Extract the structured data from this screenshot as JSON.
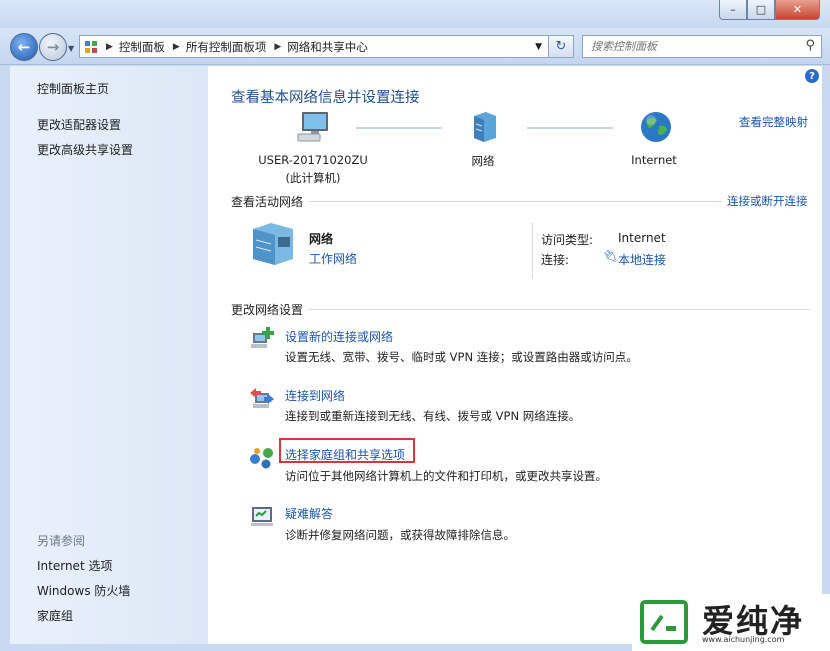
{
  "window": {
    "min_icon": "minimize-icon",
    "max_icon": "maximize-icon",
    "close_icon": "close-icon"
  },
  "nav": {
    "breadcrumbs": [
      "控制面板",
      "所有控制面板项",
      "网络和共享中心"
    ],
    "search_placeholder": "搜索控制面板"
  },
  "sidebar": {
    "home": "控制面板主页",
    "items": [
      "更改适配器设置",
      "更改高级共享设置"
    ],
    "see_also_title": "另请参阅",
    "see_also": [
      "Internet 选项",
      "Windows 防火墙",
      "家庭组"
    ]
  },
  "main": {
    "title": "查看基本网络信息并设置连接",
    "full_map_link": "查看完整映射",
    "map": {
      "computer_name": "USER-20171020ZU",
      "computer_sub": "(此计算机)",
      "network": "网络",
      "internet": "Internet"
    },
    "active_section": "查看活动网络",
    "connect_disconnect": "连接或断开连接",
    "active_network": {
      "name": "网络",
      "type_link": "工作网络",
      "access_label": "访问类型:",
      "access_value": "Internet",
      "conn_label": "连接:",
      "conn_value": "本地连接"
    },
    "change_section": "更改网络设置",
    "tasks": [
      {
        "title": "设置新的连接或网络",
        "desc": "设置无线、宽带、拨号、临时或 VPN 连接；或设置路由器或访问点。"
      },
      {
        "title": "连接到网络",
        "desc": "连接到或重新连接到无线、有线、拨号或 VPN 网络连接。"
      },
      {
        "title": "选择家庭组和共享选项",
        "desc": "访问位于其他网络计算机上的文件和打印机，或更改共享设置。"
      },
      {
        "title": "疑难解答",
        "desc": "诊断并修复网络问题，或获得故障排除信息。"
      }
    ]
  },
  "watermark": {
    "text": "爱纯净",
    "url": "www.aichunjing.com"
  },
  "colors": {
    "link": "#1a55b5",
    "title": "#1f4f96",
    "highlight": "#d23a3a",
    "brand": "#2d9a3a"
  }
}
